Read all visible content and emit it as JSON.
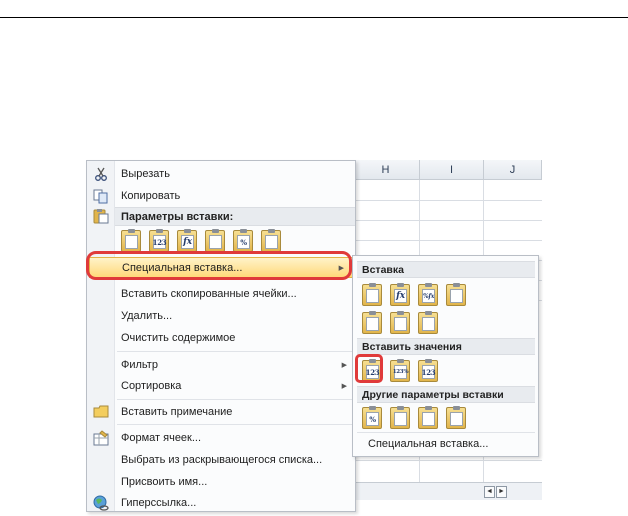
{
  "sheet": {
    "columns": [
      "H",
      "I",
      "J"
    ],
    "scroll_left": "◄",
    "scroll_right": "►"
  },
  "menu": {
    "cut": "Вырезать",
    "copy": "Копировать",
    "paste_options_header": "Параметры вставки:",
    "paste_options_tiles": [
      "",
      "123",
      "fx",
      "",
      "%",
      ""
    ],
    "paste_special": "Специальная вставка...",
    "insert_copied": "Вставить скопированные ячейки...",
    "delete": "Удалить...",
    "clear_contents": "Очистить содержимое",
    "filter": "Фильтр",
    "sort": "Сортировка",
    "insert_comment": "Вставить примечание",
    "format_cells": "Формат ячеек...",
    "pick_from_list": "Выбрать из раскрывающегося списка...",
    "define_name": "Присвоить имя...",
    "hyperlink": "Гиперссылка..."
  },
  "submenu": {
    "paste_header": "Вставка",
    "paste_tiles_row1": [
      "",
      "fx",
      "%fx",
      ""
    ],
    "paste_tiles_row2": [
      "",
      "",
      ""
    ],
    "values_header": "Вставить значения",
    "values_tiles": [
      "123",
      "123%",
      "123"
    ],
    "other_header": "Другие параметры вставки",
    "other_tiles": [
      "%",
      "",
      "",
      ""
    ],
    "paste_special": "Специальная вставка..."
  },
  "colors": {
    "highlight_ring": "#e03a3a",
    "hover_gradient_top": "#fff3c9",
    "hover_gradient_bottom": "#ffd97a",
    "tile_gold": "#e2b54b"
  }
}
